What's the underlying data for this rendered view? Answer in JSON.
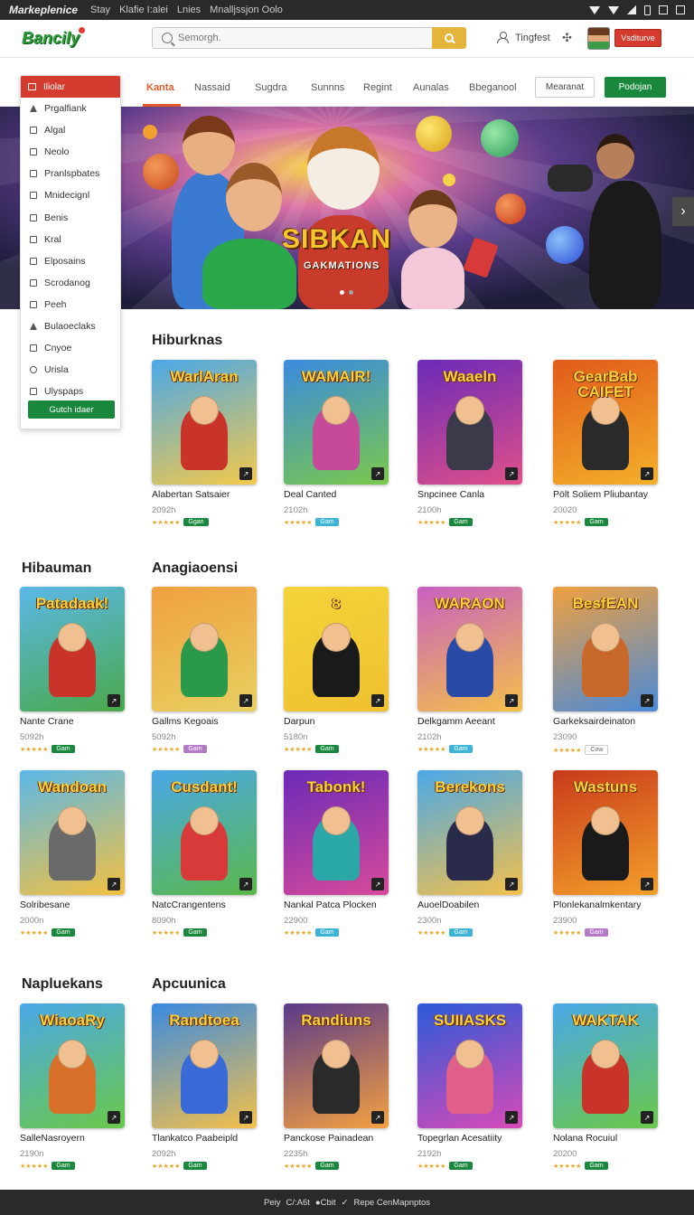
{
  "statusbar": {
    "title": "Markeplenice",
    "links": [
      "Stay",
      "Klafie I:alei",
      "Lnies",
      "Mnalljssjon Oolo"
    ]
  },
  "header": {
    "logo": "Bancily",
    "search_placeholder": "Semorgh.",
    "user_label": "Tingfest",
    "cta_label": "Vsditurve"
  },
  "nav": {
    "tabs": [
      "Kanta",
      "Nassaid",
      "Sugdra",
      "Sunnns",
      "Regint",
      "Aunalas",
      "Bbeganool"
    ],
    "outline_button": "Mearanat",
    "green_button": "Podojan"
  },
  "hero": {
    "title": "SIBKAN",
    "subtitle": "GAKMATIONS"
  },
  "sidemenu": {
    "header": "Iliolar",
    "items": [
      "Prgalfiank",
      "Algal",
      "Neolo",
      "Pranlspbates",
      "Mnidecignl",
      "Benis",
      "Kral",
      "Elposains",
      "Scrodanog",
      "Peeh",
      "Bulaoeclaks",
      "Cnyoe",
      "Urisla",
      "Ulyspaps"
    ],
    "button": "Gutch idaer"
  },
  "sections": {
    "s1": "Hiburknas",
    "s2a": "Hibauman",
    "s2b": "Anagiaoensi",
    "s3a": "Napluekans",
    "s3b": "Apcuunica"
  },
  "cards": [
    {
      "title": "WarlAran",
      "name": "Alabertan Satsaier",
      "meta": "2092h",
      "badge": "Ggan",
      "badge_color": "#19883d",
      "bg1": "#4aa8e8",
      "bg2": "#f4c94a",
      "fig": "#c8342a"
    },
    {
      "title": "WAMAIR!",
      "name": "Deal Canted",
      "meta": "2102h",
      "badge": "Gam",
      "badge_color": "#3bb4d8",
      "bg1": "#3a8ae0",
      "bg2": "#7ac84a",
      "fig": "#c54a9a"
    },
    {
      "title": "Waaeln",
      "name": "Snpcinee Canla",
      "meta": "2100h",
      "badge": "Gam",
      "badge_color": "#19883d",
      "bg1": "#6a2ab8",
      "bg2": "#e0508a",
      "fig": "#3a3a4a"
    },
    {
      "title": "GearBab CAIFET",
      "name": "Pölt Soliem Pliubantay",
      "meta": "20020",
      "badge": "Gam",
      "badge_color": "#19883d",
      "bg1": "#e05a1a",
      "bg2": "#f4b02a",
      "fig": "#2a2a2a"
    },
    {
      "title": "Patadaak!",
      "name": "Nante Crane",
      "meta": "5092h",
      "badge": "Gam",
      "badge_color": "#19883d",
      "bg1": "#5ab8e8",
      "bg2": "#4aa84a",
      "fig": "#c8342a"
    },
    {
      "title": "",
      "name": "Gallms Kegoais",
      "meta": "5092h",
      "badge": "Gam",
      "badge_color": "#b47ac8",
      "bg1": "#f0a040",
      "bg2": "#e8d060",
      "fig": "#2a9a4a"
    },
    {
      "title": "8",
      "name": "Darpun",
      "meta": "5180n",
      "badge": "Gam",
      "badge_color": "#19883d",
      "bg1": "#f4d43a",
      "bg2": "#f0c030",
      "fig": "#1a1a1a"
    },
    {
      "title": "WARAON",
      "name": "Delkgamm Aeeant",
      "meta": "2102h",
      "badge": "Gam",
      "badge_color": "#3bb4d8",
      "bg1": "#c860c0",
      "bg2": "#f4c04a",
      "fig": "#2a4aa8"
    },
    {
      "title": "BesfEAN",
      "name": "Garkeksairdeinaton",
      "meta": "23090",
      "badge": "Cow",
      "badge_color": "#cccccc",
      "bg1": "#f0a040",
      "bg2": "#4a8ad8",
      "fig": "#c8682a"
    },
    {
      "title": "Wandoan",
      "name": "Solribesane",
      "meta": "2000n",
      "badge": "Gam",
      "badge_color": "#19883d",
      "bg1": "#5ab8e8",
      "bg2": "#f4c040",
      "fig": "#6a6a6a"
    },
    {
      "title": "Cusdant!",
      "name": "NatcCrangentens",
      "meta": "8090h",
      "badge": "Gam",
      "badge_color": "#19883d",
      "bg1": "#4aa8e8",
      "bg2": "#5ab84a",
      "fig": "#d83a3a"
    },
    {
      "title": "Tabonk!",
      "name": "Nankal Patca Plocken",
      "meta": "22900",
      "badge": "Gam",
      "badge_color": "#3bb4d8",
      "bg1": "#6a2ab8",
      "bg2": "#d84a9a",
      "fig": "#2aa8a8"
    },
    {
      "title": "Berekons",
      "name": "AuoelDoabilen",
      "meta": "2300n",
      "badge": "Gam",
      "badge_color": "#3bb4d8",
      "bg1": "#4aa8e8",
      "bg2": "#f4c04a",
      "fig": "#2a2a4a"
    },
    {
      "title": "Wastuns",
      "name": "Plonlekanalmkentary",
      "meta": "23900",
      "badge": "Gam",
      "badge_color": "#b47ac8",
      "bg1": "#c83a1a",
      "bg2": "#f4a02a",
      "fig": "#1a1a1a"
    },
    {
      "title": "WiaoaRy",
      "name": "SalleNasroyern",
      "meta": "2190n",
      "badge": "Gam",
      "badge_color": "#19883d",
      "bg1": "#4aa8e8",
      "bg2": "#6ac84a",
      "fig": "#d8702a"
    },
    {
      "title": "Randtoea",
      "name": "Tlankatco Paabeipld",
      "meta": "2092h",
      "badge": "Gam",
      "badge_color": "#19883d",
      "bg1": "#3a8ae0",
      "bg2": "#f4c04a",
      "fig": "#3a6ad8"
    },
    {
      "title": "Randiuns",
      "name": "Panckose Painadean",
      "meta": "2235h",
      "badge": "Gam",
      "badge_color": "#19883d",
      "bg1": "#5a3a8a",
      "bg2": "#f4a040",
      "fig": "#2a2a2a"
    },
    {
      "title": "SUIIASKS",
      "name": "Topegrlan Acesatiity",
      "meta": "2192h",
      "badge": "Gam",
      "badge_color": "#19883d",
      "bg1": "#2a5ad8",
      "bg2": "#d84ab8",
      "fig": "#e0608a"
    },
    {
      "title": "WAKTAK",
      "name": "Nolana Rocuiul",
      "meta": "20200",
      "badge": "Gam",
      "badge_color": "#19883d",
      "bg1": "#4aa8e8",
      "bg2": "#6ac84a",
      "fig": "#c8342a"
    }
  ],
  "footer": {
    "items": [
      "Peiy",
      "C/:A6t",
      "●Cbit",
      "✓",
      "Repe CenMapnptos"
    ]
  },
  "colors": {
    "accent_red": "#d53a2e",
    "accent_green": "#19883d",
    "accent_orange": "#e0592a",
    "search_button": "#e5b43a"
  }
}
